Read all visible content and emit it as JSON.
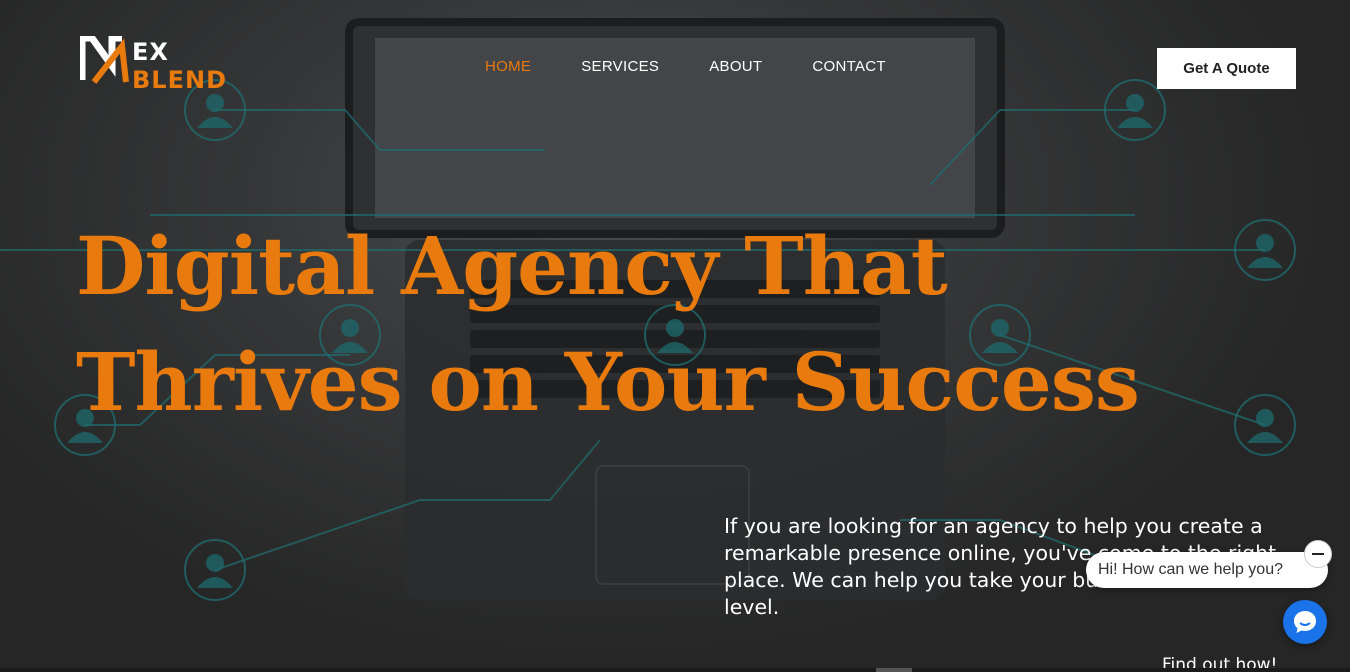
{
  "brand": {
    "logo_line1": "EX",
    "logo_line2": "BLEND",
    "accent_color": "#e87a0e"
  },
  "nav": {
    "items": [
      {
        "label": "HOME",
        "active": true
      },
      {
        "label": "SERVICES",
        "active": false
      },
      {
        "label": "ABOUT",
        "active": false
      },
      {
        "label": "CONTACT",
        "active": false
      }
    ]
  },
  "header": {
    "cta_label": "Get A Quote"
  },
  "hero": {
    "headline_line1": "Digital Agency That",
    "headline_line2": "Thrives on Your Success",
    "paragraph": "If you are looking for an agency to help you create a remarkable presence online, you've come to the right place. We can help you take your business to the next level.",
    "link_label": "Find out how!"
  },
  "chat": {
    "greeting": "Hi! How can we help you?",
    "launcher_icon": "chat-bubble-icon",
    "close_icon": "minimize-icon",
    "launcher_color": "#1a73e8"
  }
}
